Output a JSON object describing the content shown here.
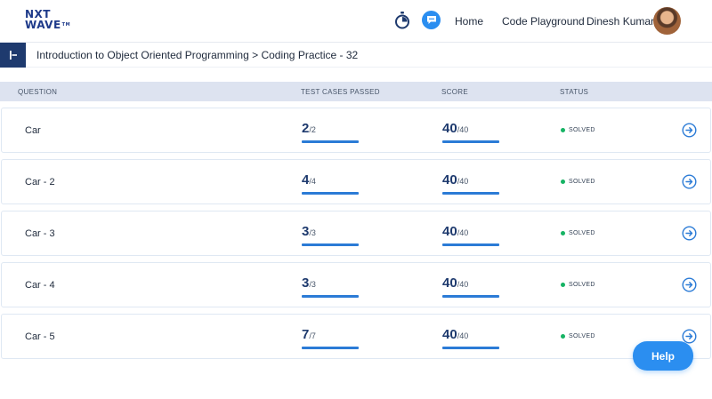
{
  "header": {
    "logo_line1": "NXT",
    "logo_line2": "WAVE",
    "logo_tm": "TM",
    "nav_home": "Home",
    "nav_playground": "Code Playground",
    "user_name": "Dinesh Kumar",
    "icons": [
      "timer-icon",
      "chat-icon",
      "avatar"
    ]
  },
  "breadcrumb": {
    "text": "Introduction to Object Oriented Programming > Coding Practice - 32"
  },
  "table": {
    "columns": [
      "QUESTION",
      "TEST CASES PASSED",
      "SCORE",
      "STATUS"
    ],
    "rows": [
      {
        "question": "Car",
        "passed": "2",
        "total": "/2",
        "score": "40",
        "max": "/40",
        "status": "SOLVED"
      },
      {
        "question": "Car - 2",
        "passed": "4",
        "total": "/4",
        "score": "40",
        "max": "/40",
        "status": "SOLVED"
      },
      {
        "question": "Car - 3",
        "passed": "3",
        "total": "/3",
        "score": "40",
        "max": "/40",
        "status": "SOLVED"
      },
      {
        "question": "Car - 4",
        "passed": "3",
        "total": "/3",
        "score": "40",
        "max": "/40",
        "status": "SOLVED"
      },
      {
        "question": "Car - 5",
        "passed": "7",
        "total": "/7",
        "score": "40",
        "max": "/40",
        "status": "SOLVED"
      }
    ]
  },
  "help": {
    "label": "Help"
  },
  "colors": {
    "accent": "#2b8ef0",
    "brand_dark": "#1e3a6e",
    "solved": "#16b364",
    "table_header": "#dde3f0"
  }
}
